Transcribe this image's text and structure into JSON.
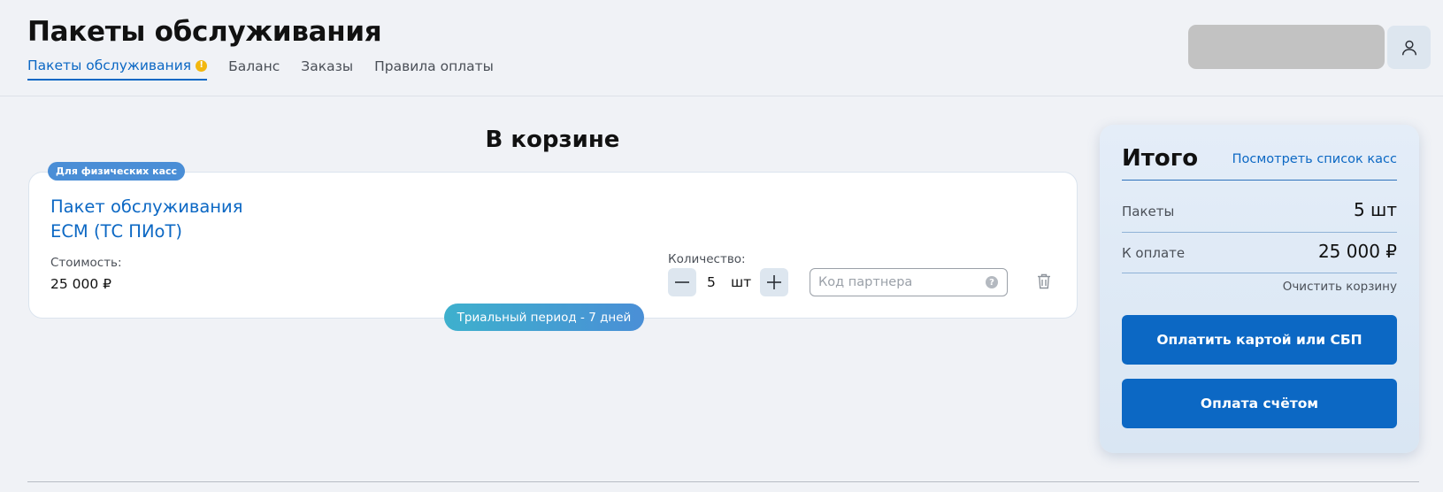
{
  "header": {
    "title": "Пакеты обслуживания",
    "tabs": [
      {
        "label": "Пакеты обслуживания",
        "active": true,
        "has_warning": true
      },
      {
        "label": "Баланс"
      },
      {
        "label": "Заказы"
      },
      {
        "label": "Правила оплаты"
      }
    ],
    "warning_glyph": "!"
  },
  "cart": {
    "title": "В корзине",
    "item": {
      "badge": "Для физических касс",
      "name_line1": "Пакет обслуживания",
      "name_line2": "ЕСМ (ТС ПИоТ)",
      "cost_label": "Стоимость:",
      "cost_value": "25 000 ₽",
      "quantity_label": "Количество:",
      "quantity_value": "5",
      "quantity_unit": "шт",
      "partner_code_placeholder": "Код партнера",
      "help_glyph": "?",
      "trial_label": "Триальный период - 7 дней"
    }
  },
  "summary": {
    "title": "Итого",
    "view_list_link": "Посмотреть список касс",
    "packages_label": "Пакеты",
    "packages_value": "5 шт",
    "to_pay_label": "К оплате",
    "to_pay_value": "25 000 ₽",
    "clear_cart": "Очистить корзину",
    "pay_card_button": "Оплатить картой или СБП",
    "pay_invoice_button": "Оплата счётом"
  },
  "colors": {
    "accent": "#0c68c4",
    "badge_blue": "#4a8ed6",
    "warning": "#f2b70f",
    "background": "#f0f2f6"
  },
  "icons": {
    "user": "user-icon",
    "minus": "minus-icon",
    "plus": "plus-icon",
    "trash": "trash-icon",
    "help": "help-icon",
    "warning": "warning-icon"
  }
}
